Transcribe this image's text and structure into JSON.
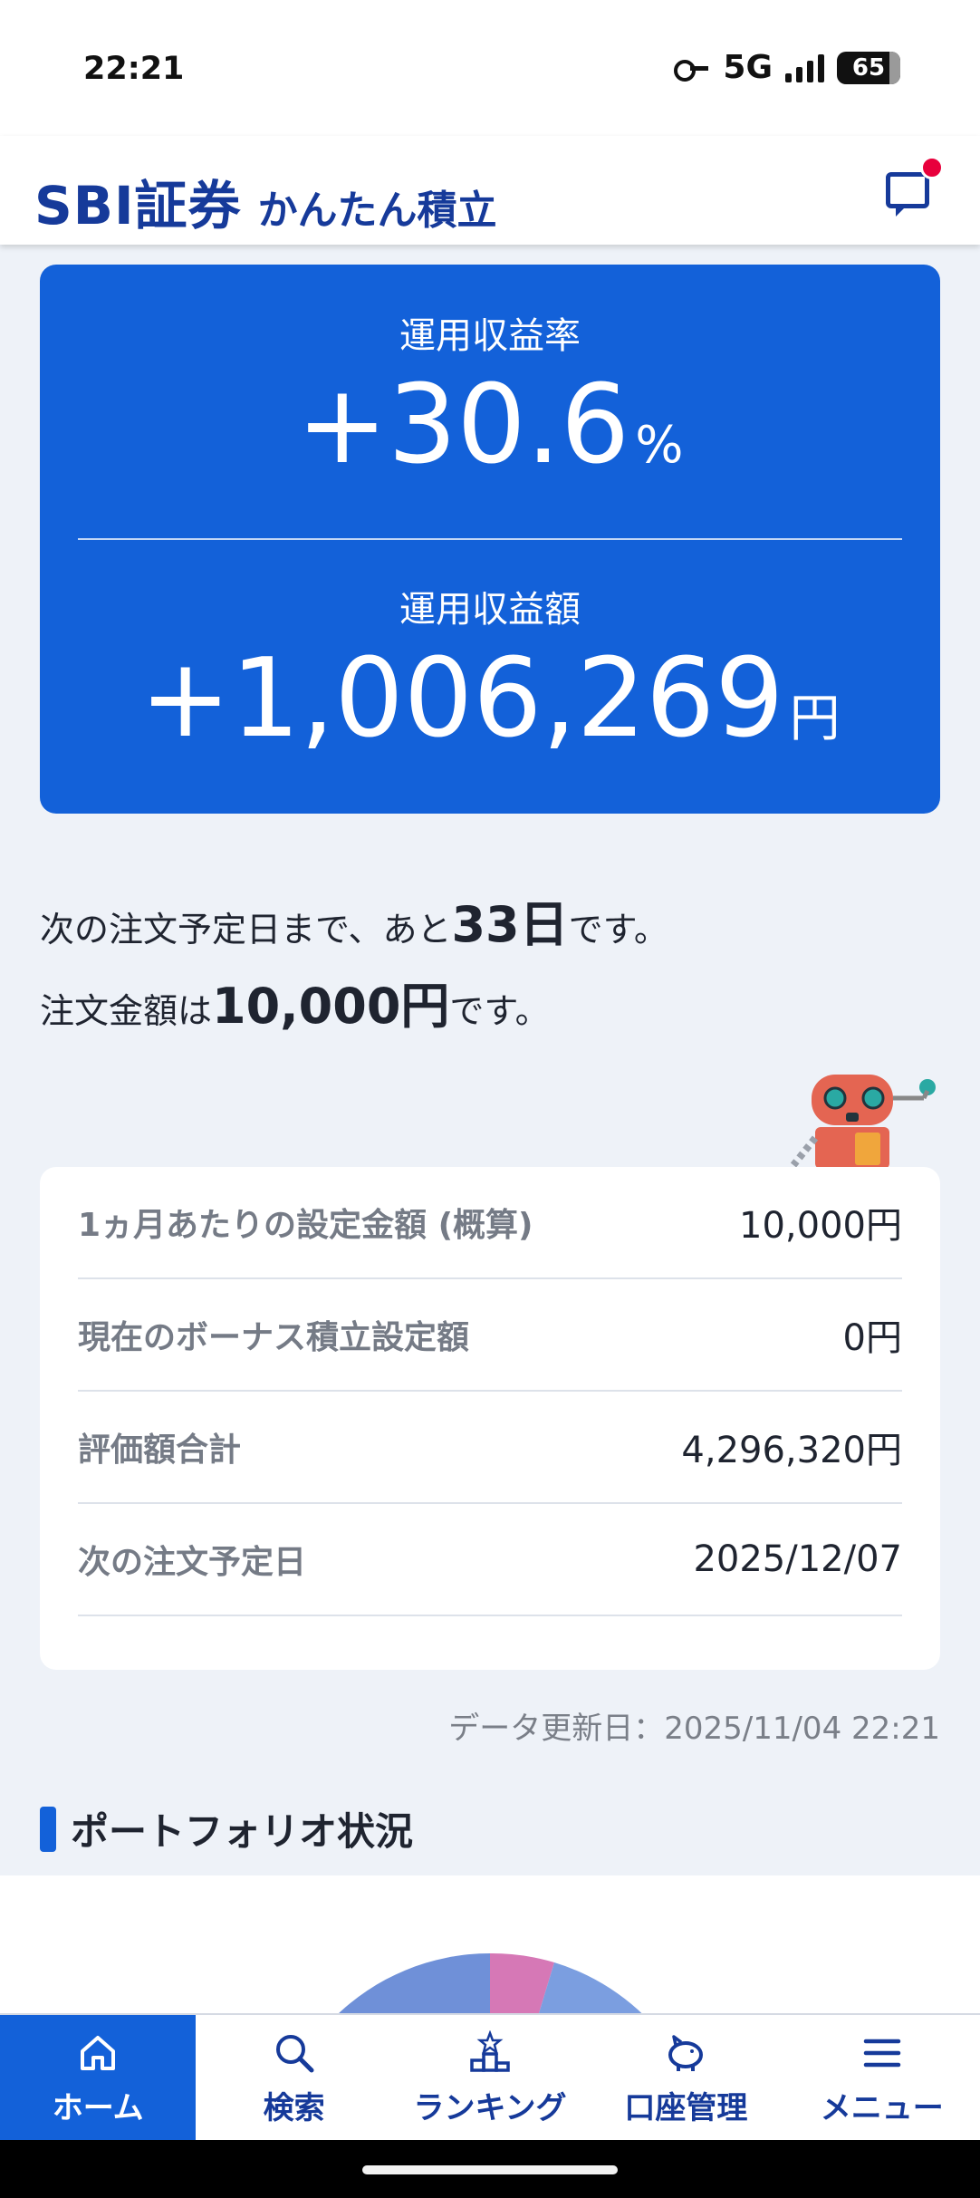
{
  "status_bar": {
    "time": "22:21",
    "network": "5G",
    "battery": "65"
  },
  "header": {
    "brand": "SBI証券",
    "product": "かんたん積立"
  },
  "summary": {
    "rate_label": "運用収益率",
    "rate_value": "+30.6",
    "rate_unit": "%",
    "amount_label": "運用収益額",
    "amount_value": "+1,006,269",
    "amount_unit": "円"
  },
  "order_info": {
    "line1_prefix": "次の注文予定日まで、あと",
    "days": "33日",
    "line1_suffix": "です。",
    "line2_prefix": "注文金額は",
    "amount": "10,000円",
    "line2_suffix": "です。"
  },
  "details": [
    {
      "label": "1ヵ月あたりの設定金額 (概算)",
      "value": "10,000円"
    },
    {
      "label": "現在のボーナス積立設定額",
      "value": "0円"
    },
    {
      "label": "評価額合計",
      "value": "4,296,320円"
    },
    {
      "label": "次の注文予定日",
      "value": "2025/12/07"
    }
  ],
  "updated": "データ更新日：2025/11/04 22:21",
  "portfolio": {
    "title": "ポートフォリオ状況"
  },
  "nav": [
    {
      "label": "ホーム",
      "icon": "home-icon"
    },
    {
      "label": "検索",
      "icon": "search-icon"
    },
    {
      "label": "ランキング",
      "icon": "ranking-icon"
    },
    {
      "label": "口座管理",
      "icon": "piggy-bank-icon"
    },
    {
      "label": "メニュー",
      "icon": "menu-icon"
    }
  ],
  "colors": {
    "primary": "#1361d9",
    "brand": "#163a9a",
    "notify": "#e8003c",
    "background": "#eef2f8"
  }
}
